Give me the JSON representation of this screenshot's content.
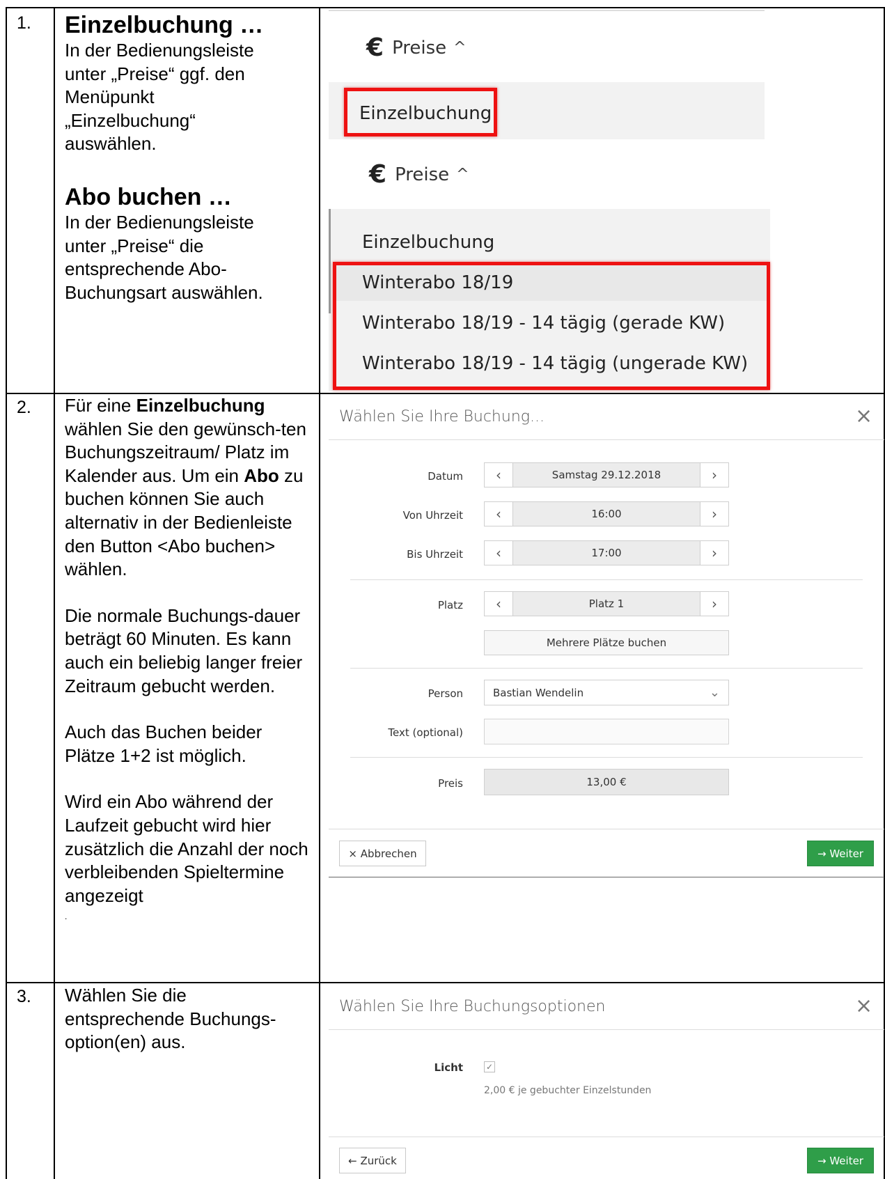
{
  "rows": [
    {
      "number": "1.",
      "text_blocks": [
        {
          "heading": "Einzelbuchung …",
          "lines": [
            "In der Bedienungsleiste",
            "unter „Preise“ ggf. den",
            "Menüpunkt",
            "„Einzelbuchung“",
            "auswählen."
          ]
        },
        {
          "heading": "Abo buchen …",
          "lines": [
            "In der Bedienungsleiste",
            "unter „Preise“ die",
            "entsprechende Abo-",
            "Buchungsart auswählen."
          ]
        }
      ]
    },
    {
      "number": "2.",
      "p1": {
        "pre": "Für eine ",
        "b1": "Einzelbuchung",
        "mid1": " wählen Sie den gewünsch-ten Buchungszeitraum/ Platz im Kalender aus. Um ein ",
        "b2": "Abo",
        "post": " zu buchen können Sie auch alternativ in der Bedienleiste den Button <Abo buchen> wählen."
      },
      "p2": "Die normale Buchungs-dauer beträgt 60 Minuten. Es kann auch ein beliebig langer freier Zeitraum gebucht werden.",
      "p3": "Auch das Buchen beider Plätze 1+2 ist möglich.",
      "p4": "Wird ein Abo während der Laufzeit gebucht wird hier zusätzlich die Anzahl der noch verbleibenden Spieltermine angezeigt",
      "p5": "."
    },
    {
      "number": "3.",
      "text": "Wählen Sie die entsprechende Buchungs-option(en) aus."
    }
  ],
  "menu1": {
    "euro": "€",
    "label": "Preise",
    "chevron": "^",
    "item": "Einzelbuchung"
  },
  "menu2": {
    "euro": "€",
    "label": "Preise",
    "chevron": "^",
    "items": [
      "Einzelbuchung",
      "Winterabo 18/19",
      "Winterabo 18/19 - 14 tägig (gerade KW)",
      "Winterabo 18/19 - 14 tägig (ungerade KW)"
    ]
  },
  "dialog1": {
    "title": "Wählen Sie Ihre Buchung...",
    "close": "×",
    "date_label": "Datum",
    "date_value": "Samstag 29.12.2018",
    "from_label": "Von Uhrzeit",
    "from_value": "16:00",
    "to_label": "Bis Uhrzeit",
    "to_value": "17:00",
    "court_label": "Platz",
    "court_value": "Platz 1",
    "multi_button": "Mehrere Plätze buchen",
    "person_label": "Person",
    "person_value": "Bastian Wendelin",
    "text_label": "Text (optional)",
    "price_label": "Preis",
    "price_value": "13,00 €",
    "cancel": "× Abbrechen",
    "next": "→ Weiter",
    "arrow_left": "‹",
    "arrow_right": "›",
    "select_chevron": "⌄"
  },
  "dialog2": {
    "title": "Wählen Sie Ihre Buchungsoptionen",
    "close": "×",
    "option_label": "Licht",
    "option_checked": "✓",
    "option_note": "2,00 € je gebuchter Einzelstunden",
    "back": "← Zurück",
    "next": "→ Weiter"
  }
}
